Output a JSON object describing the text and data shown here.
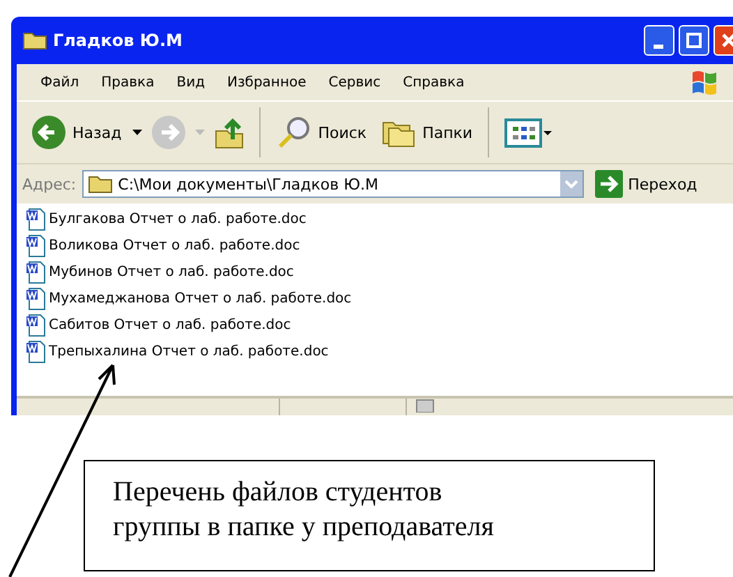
{
  "window": {
    "title": "Гладков Ю.М"
  },
  "menu": [
    {
      "label": "Файл"
    },
    {
      "label": "Правка"
    },
    {
      "label": "Вид"
    },
    {
      "label": "Избранное"
    },
    {
      "label": "Сервис"
    },
    {
      "label": "Справка"
    }
  ],
  "toolbar": {
    "back": "Назад",
    "search": "Поиск",
    "folders": "Папки"
  },
  "address": {
    "label": "Адрес:",
    "value": "C:\\Мои документы\\Гладков Ю.М",
    "go": "Переход"
  },
  "files": [
    {
      "name": "Булгакова Отчет о лаб. работе.doc"
    },
    {
      "name": "Воликова Отчет о лаб. работе.doc"
    },
    {
      "name": "Мубинов Отчет о лаб. работе.doc"
    },
    {
      "name": "Мухамеджанова Отчет о лаб. работе.doc"
    },
    {
      "name": "Сабитов Отчет о лаб. работе.doc"
    },
    {
      "name": "Трепыхалина Отчет о лаб. работе.doc"
    }
  ],
  "callout": {
    "lines": [
      "Перечень файлов студентов",
      "группы в папке у преподавателя"
    ]
  }
}
